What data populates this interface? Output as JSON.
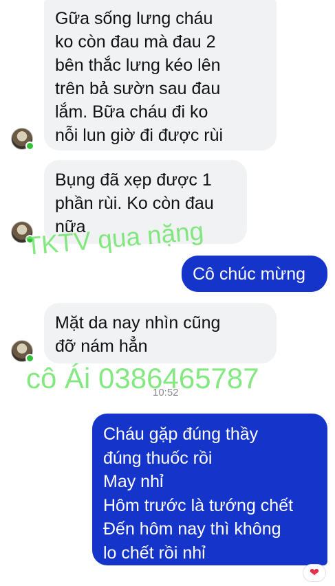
{
  "messages": [
    {
      "lines": [
        "Gữa  sống  lưng  cháu",
        "ko còn  đau  mà đau  2",
        "bên  thắc  lưng kéo  lên",
        "trên  bả  sườn  sau đau",
        "lắm. Bữa  cháu  đi  ko",
        "nỗi  lun giờ  đi  được  rùi"
      ]
    },
    {
      "lines": [
        "Bụng đã  xẹp  được 1",
        "phần rùi. Ko còn đau",
        "nữa"
      ]
    },
    {
      "lines": [
        "Cô chúc mừng"
      ]
    },
    {
      "lines": [
        "Mặt da  nay nhìn  cũng",
        "đỡ nám hẳn"
      ]
    },
    {
      "lines": [
        "Cháu gặp đúng thầy",
        "đúng thuốc rồi",
        "May nhỉ",
        "Hôm trước là tướng chết",
        "Đến hôm nay thì không",
        "lo chết rồi nhỉ"
      ]
    }
  ],
  "watermarks": {
    "line1": "TKTV qua nặng",
    "line2": "cô Ái 0386465787"
  },
  "timestamp": "10:52",
  "reaction": {
    "icon": "heart-icon",
    "glyph": "❤",
    "color": "#e4314a"
  },
  "colors": {
    "incoming_bubble": "#f1f2f4",
    "outgoing_bubble": "#1534c9",
    "watermark": "#6ee46a",
    "online": "#31c23a"
  }
}
